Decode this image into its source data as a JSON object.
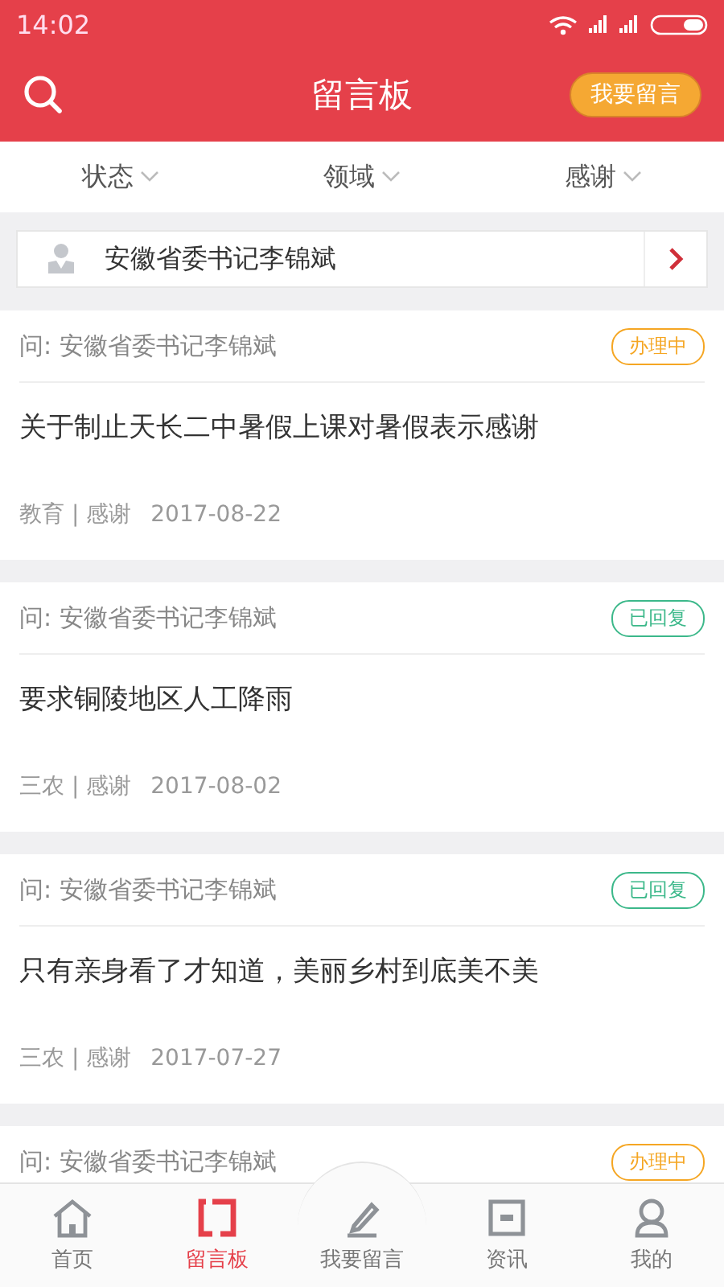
{
  "status_bar": {
    "time": "14:02"
  },
  "header": {
    "title": "留言板",
    "action": "我要留言"
  },
  "filters": [
    {
      "label": "状态"
    },
    {
      "label": "领域"
    },
    {
      "label": "感谢"
    }
  ],
  "leader": {
    "name": "安徽省委书记李锦斌"
  },
  "messages": [
    {
      "to": "问: 安徽省委书记李锦斌",
      "status": "办理中",
      "color": "#f5a623",
      "title": "关于制止天长二中暑假上课对暑假表示感谢",
      "tags": "教育 | 感谢",
      "date": "2017-08-22"
    },
    {
      "to": "问: 安徽省委书记李锦斌",
      "status": "已回复",
      "color": "#3cb88a",
      "title": "要求铜陵地区人工降雨",
      "tags": "三农 | 感谢",
      "date": "2017-08-02"
    },
    {
      "to": "问: 安徽省委书记李锦斌",
      "status": "已回复",
      "color": "#3cb88a",
      "title": "只有亲身看了才知道，美丽乡村到底美不美",
      "tags": "三农 | 感谢",
      "date": "2017-07-27"
    },
    {
      "to": "问: 安徽省委书记李锦斌",
      "status": "办理中",
      "color": "#f5a623"
    }
  ],
  "nav": [
    {
      "label": "首页",
      "selected": false
    },
    {
      "label": "留言板",
      "selected": true
    },
    {
      "label": "我要留言",
      "selected": false
    },
    {
      "label": "资讯",
      "selected": false
    },
    {
      "label": "我的",
      "selected": false
    }
  ]
}
